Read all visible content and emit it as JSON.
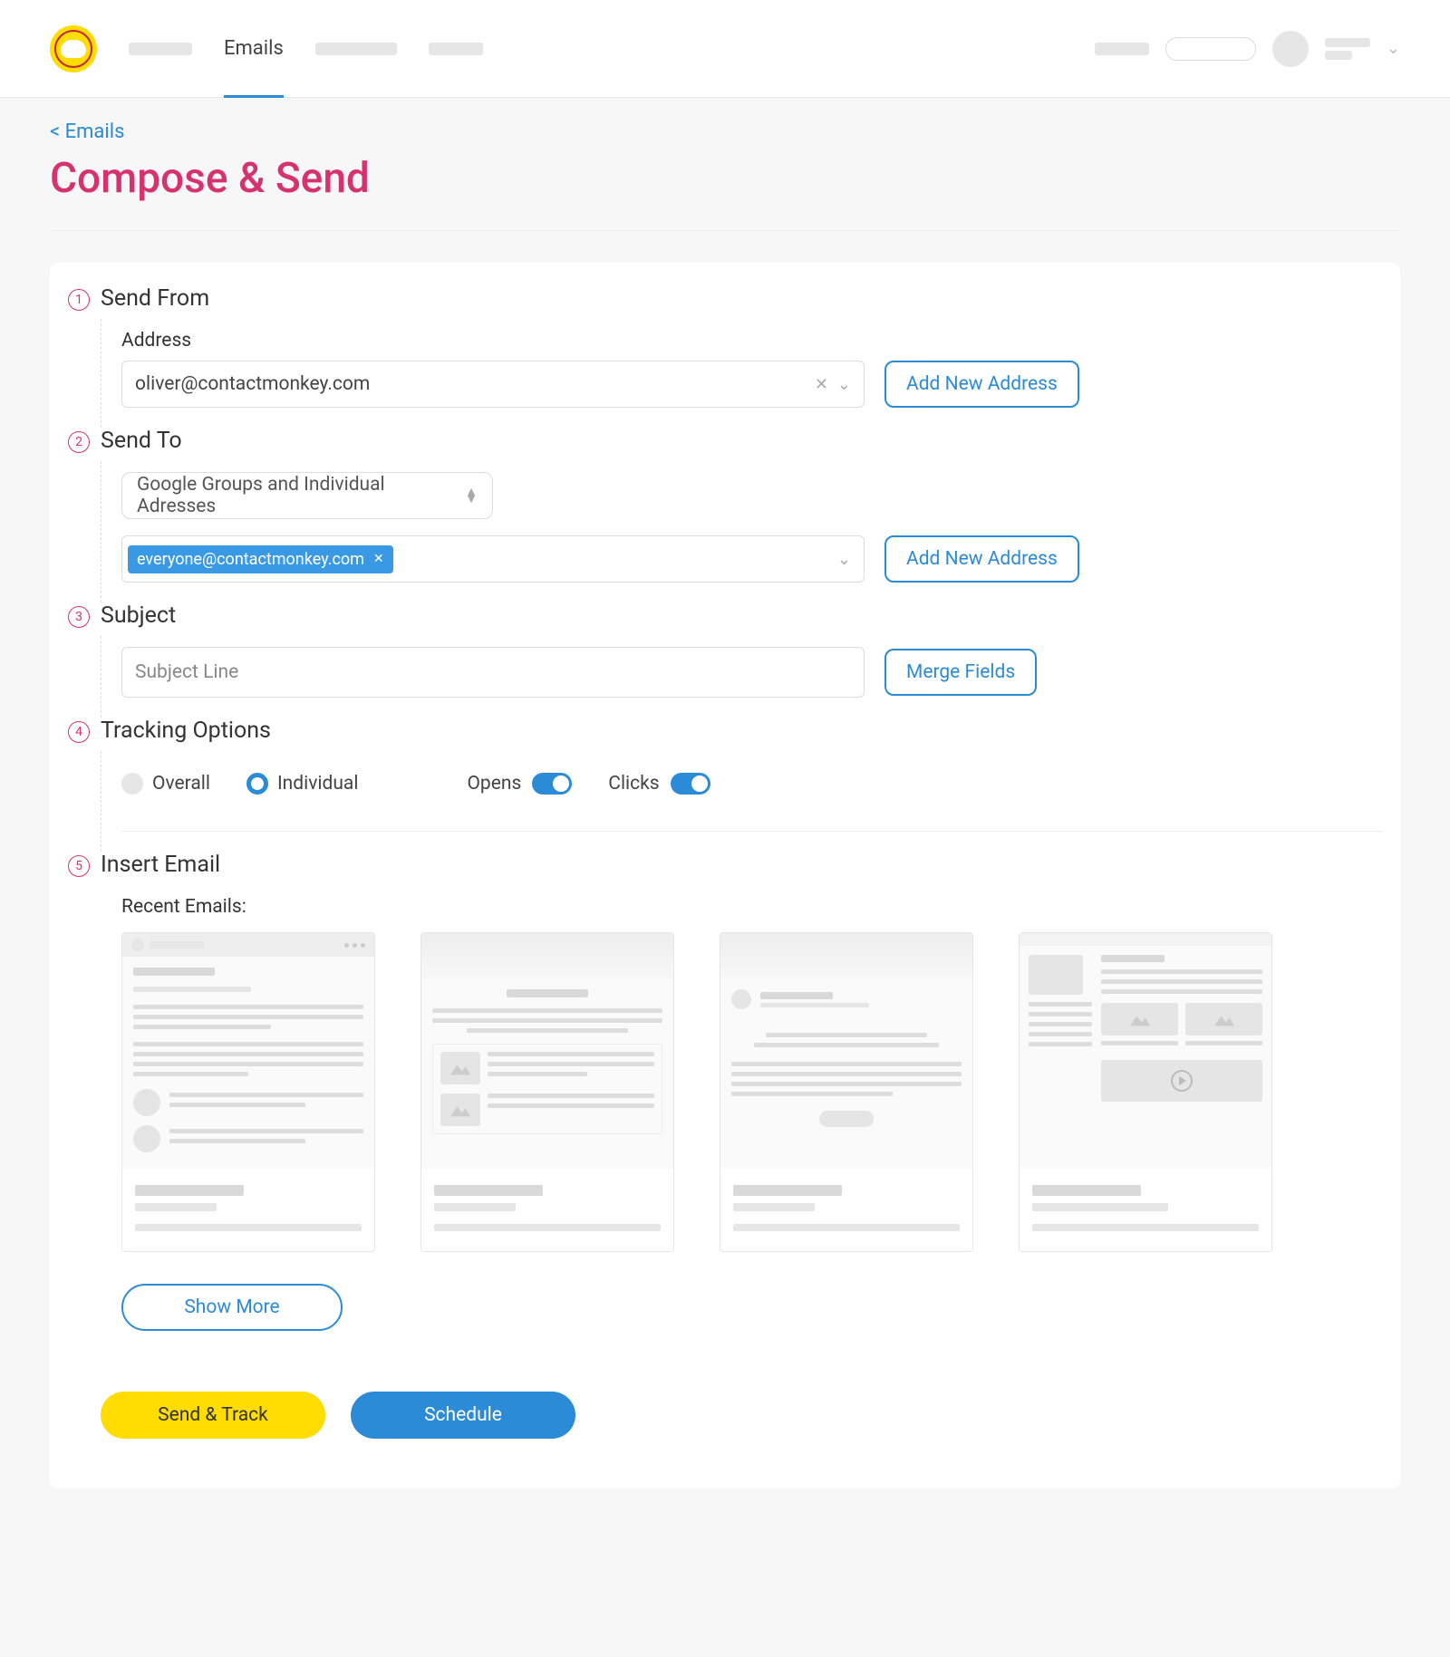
{
  "nav": {
    "active_label": "Emails"
  },
  "breadcrumb": "< Emails",
  "page_title": "Compose & Send",
  "steps": {
    "send_from": {
      "num": "1",
      "title": "Send From",
      "address_label": "Address",
      "address_value": "oliver@contactmonkey.com",
      "add_button": "Add New Address"
    },
    "send_to": {
      "num": "2",
      "title": "Send To",
      "mode_label": "Google Groups and Individual Adresses",
      "chip": "everyone@contactmonkey.com",
      "add_button": "Add New Address"
    },
    "subject": {
      "num": "3",
      "title": "Subject",
      "placeholder": "Subject Line",
      "merge_button": "Merge Fields"
    },
    "tracking": {
      "num": "4",
      "title": "Tracking Options",
      "overall": "Overall",
      "individual": "Individual",
      "opens": "Opens",
      "clicks": "Clicks"
    },
    "insert": {
      "num": "5",
      "title": "Insert Email",
      "recent_label": "Recent Emails:",
      "show_more": "Show More"
    }
  },
  "footer": {
    "send_track": "Send & Track",
    "schedule": "Schedule"
  }
}
